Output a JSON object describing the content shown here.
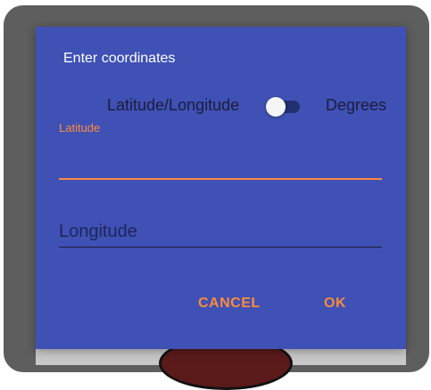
{
  "dialog": {
    "title": "Enter coordinates",
    "toggle": {
      "left_label": "Latitude/Longitude",
      "right_label": "Degrees",
      "state": "off"
    },
    "latitude": {
      "label": "Latitude",
      "value": "",
      "focused": true
    },
    "longitude": {
      "placeholder": "Longitude",
      "value": ""
    },
    "buttons": {
      "cancel": "CANCEL",
      "ok": "OK"
    }
  },
  "colors": {
    "dialog_background": "#3f51b5",
    "accent": "#ff8a3d",
    "switch_track": "#23306f",
    "switch_thumb": "#f5f5f5",
    "muted_text": "#1c1c3a"
  }
}
